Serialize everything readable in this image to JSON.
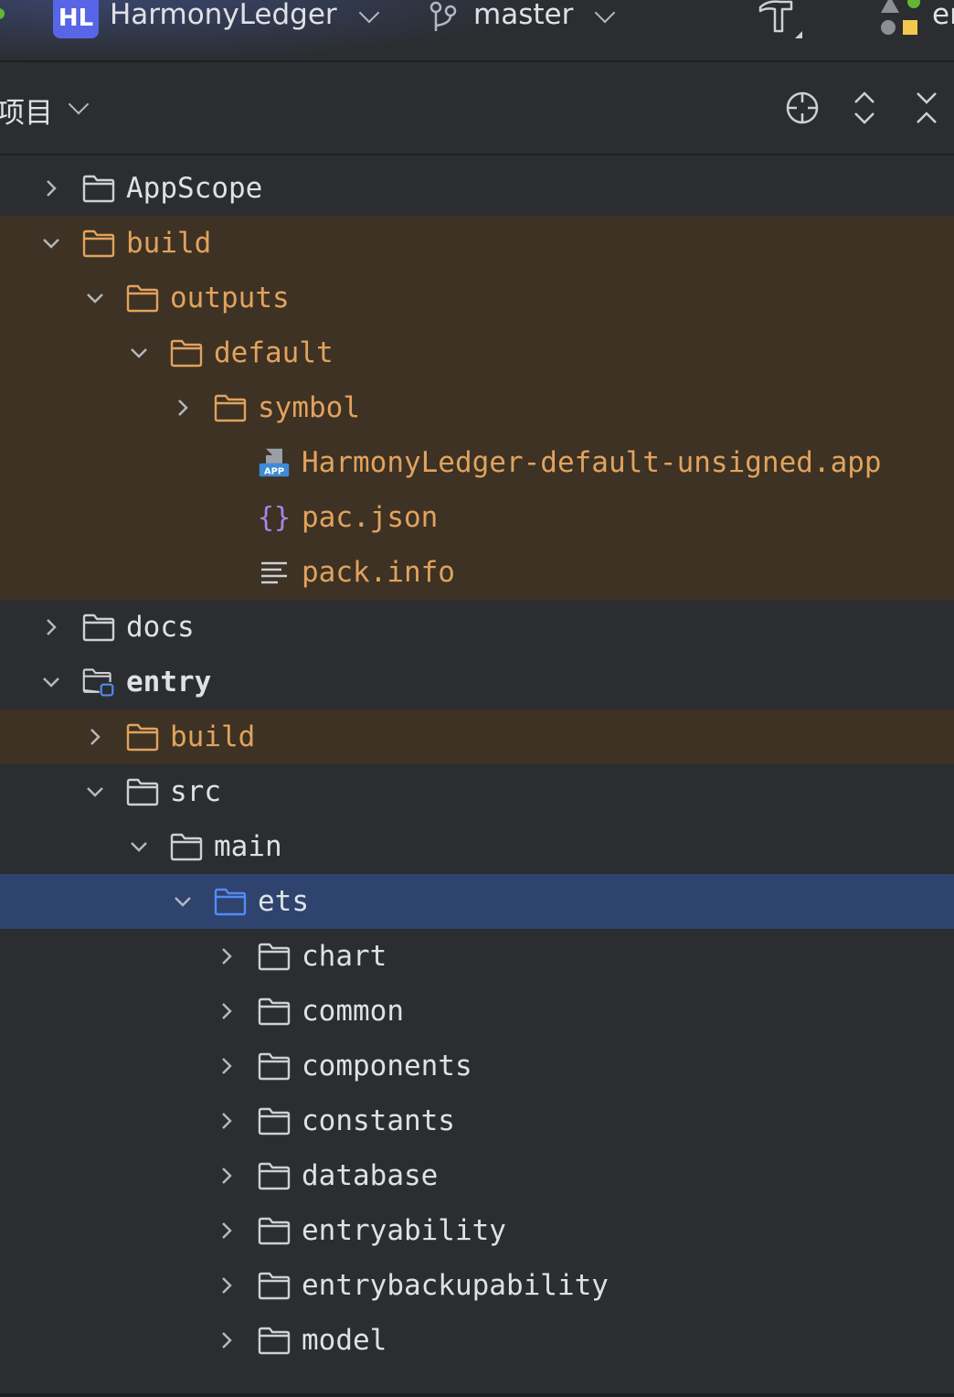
{
  "titlebar": {
    "project_badge": "HL",
    "project_name": "HarmonyLedger",
    "branch": "master",
    "run_config_partial": "er"
  },
  "panel": {
    "title": "项目"
  },
  "colors": {
    "background": "#2b2d30",
    "excluded_row": "#3d3223",
    "excluded_text": "#e2a25e",
    "selected_row": "#2e436e",
    "badge": "#5865e6",
    "folder_outline": "#ced0d6",
    "excluded_folder": "#e2a25e",
    "source_folder": "#548af7"
  },
  "tree": [
    {
      "label": "AppScope",
      "depth": 0,
      "expand": "collapsed",
      "icon": "folder-icon",
      "state": "normal"
    },
    {
      "label": "build",
      "depth": 0,
      "expand": "expanded",
      "icon": "folder-icon",
      "state": "excluded"
    },
    {
      "label": "outputs",
      "depth": 1,
      "expand": "expanded",
      "icon": "folder-icon",
      "state": "excluded"
    },
    {
      "label": "default",
      "depth": 2,
      "expand": "expanded",
      "icon": "folder-icon",
      "state": "excluded"
    },
    {
      "label": "symbol",
      "depth": 3,
      "expand": "collapsed",
      "icon": "folder-icon",
      "state": "excluded"
    },
    {
      "label": "HarmonyLedger-default-unsigned.app",
      "depth": 4,
      "expand": "none",
      "icon": "app-file-icon",
      "state": "excluded"
    },
    {
      "label": "pac.json",
      "depth": 4,
      "expand": "none",
      "icon": "json-file-icon",
      "state": "excluded"
    },
    {
      "label": "pack.info",
      "depth": 4,
      "expand": "none",
      "icon": "text-file-icon",
      "state": "excluded"
    },
    {
      "label": "docs",
      "depth": 0,
      "expand": "collapsed",
      "icon": "folder-icon",
      "state": "normal"
    },
    {
      "label": "entry",
      "depth": 0,
      "expand": "expanded",
      "icon": "module-folder-icon",
      "state": "normal",
      "bold": true
    },
    {
      "label": "build",
      "depth": 1,
      "expand": "collapsed",
      "icon": "folder-icon",
      "state": "excluded"
    },
    {
      "label": "src",
      "depth": 1,
      "expand": "expanded",
      "icon": "folder-icon",
      "state": "normal"
    },
    {
      "label": "main",
      "depth": 2,
      "expand": "expanded",
      "icon": "folder-icon",
      "state": "normal"
    },
    {
      "label": "ets",
      "depth": 3,
      "expand": "expanded",
      "icon": "source-folder-icon",
      "state": "selected"
    },
    {
      "label": "chart",
      "depth": 4,
      "expand": "collapsed",
      "icon": "folder-icon",
      "state": "normal"
    },
    {
      "label": "common",
      "depth": 4,
      "expand": "collapsed",
      "icon": "folder-icon",
      "state": "normal"
    },
    {
      "label": "components",
      "depth": 4,
      "expand": "collapsed",
      "icon": "folder-icon",
      "state": "normal"
    },
    {
      "label": "constants",
      "depth": 4,
      "expand": "collapsed",
      "icon": "folder-icon",
      "state": "normal"
    },
    {
      "label": "database",
      "depth": 4,
      "expand": "collapsed",
      "icon": "folder-icon",
      "state": "normal"
    },
    {
      "label": "entryability",
      "depth": 4,
      "expand": "collapsed",
      "icon": "folder-icon",
      "state": "normal"
    },
    {
      "label": "entrybackupability",
      "depth": 4,
      "expand": "collapsed",
      "icon": "folder-icon",
      "state": "normal"
    },
    {
      "label": "model",
      "depth": 4,
      "expand": "collapsed",
      "icon": "folder-icon",
      "state": "normal"
    }
  ]
}
